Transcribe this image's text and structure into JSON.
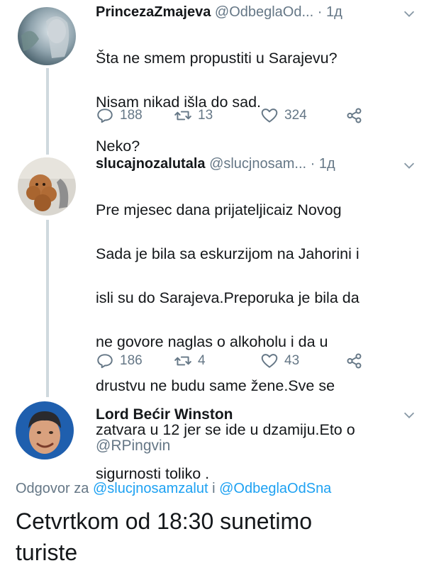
{
  "tweets": [
    {
      "display_name": "PrincezaZmajeva",
      "handle": "@OdbeglaOd...",
      "separator": "·",
      "time": "1д",
      "lines": [
        "Šta ne smem propustiti u Sarajevu?",
        "Nisam nikad išla do sad.",
        "Neko?"
      ],
      "replies": "188",
      "retweets": "13",
      "likes": "324"
    },
    {
      "display_name": "slucajnozalutala",
      "handle": "@slucjnosam...",
      "separator": "·",
      "time": "1д",
      "lines": [
        "Pre mjesec dana prijateljicaiz Novog",
        "Sada je bila sa eskurzijom na Jahorini i",
        "isli su do Sarajeva.Preporuka je bila da",
        "ne govore naglas o alkoholu i da u",
        "drustvu ne budu same žene.Sve se",
        "zatvara u 12 jer se ide u dzamiju.Eto o",
        "sigurnosti toliko ."
      ],
      "replies": "186",
      "retweets": "4",
      "likes": "43"
    }
  ],
  "main_tweet": {
    "display_name": "Lord Bećir Winston",
    "handle": "@RPingvin",
    "reply_prefix": "Odgovor za",
    "reply_user_1": "@slucjnosamzalut",
    "reply_joiner": "i",
    "reply_user_2": "@OdbeglaOdSna",
    "lines": [
      "Cetvrtkom od 18:30 sunetimo",
      "turiste"
    ]
  },
  "icons": {
    "reply": "reply-icon",
    "retweet": "retweet-icon",
    "like": "heart-icon",
    "share": "share-icon",
    "menu": "chevron-down-icon"
  },
  "colors": {
    "text": "#14171a",
    "secondary": "#657786",
    "link": "#1da1f2",
    "thread_line": "#cfd9de"
  }
}
